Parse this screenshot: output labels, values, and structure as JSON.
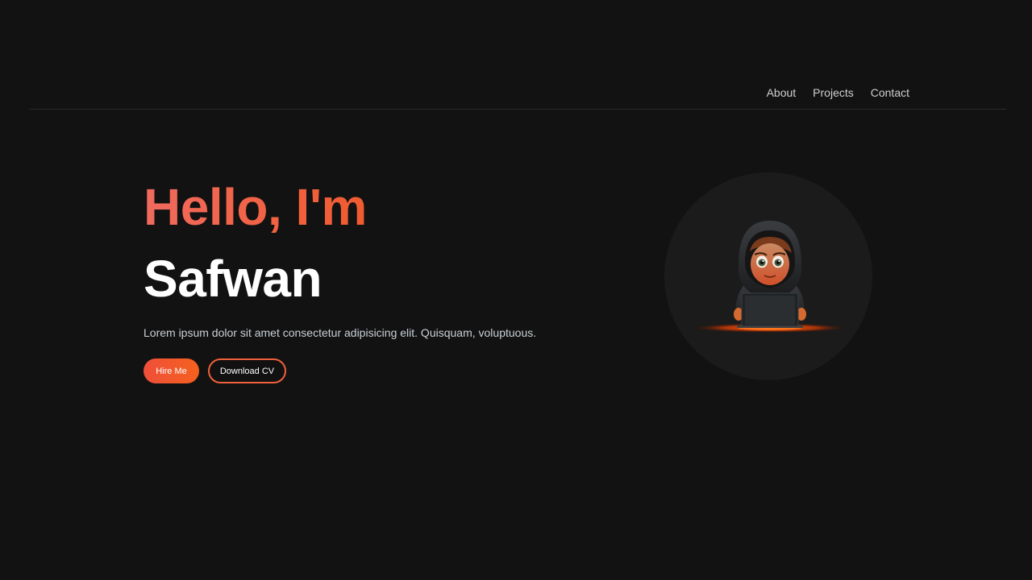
{
  "nav": {
    "links": [
      {
        "label": "About"
      },
      {
        "label": "Projects"
      },
      {
        "label": "Contact"
      }
    ]
  },
  "hero": {
    "greeting": "Hello, I'm",
    "name": "Safwan",
    "tagline": "Lorem ipsum dolor sit amet consectetur adipisicing elit. Quisquam, voluptuous.",
    "buttons": {
      "hire_label": "Hire Me",
      "cv_label": "Download CV"
    }
  },
  "colors": {
    "background": "#121212",
    "accent_orange": "#f05a2a",
    "accent_coral": "#f06a5e",
    "avatar_circle": "#1b1b1b"
  },
  "avatar": {
    "icon": "hooded-coder-avatar-icon"
  }
}
